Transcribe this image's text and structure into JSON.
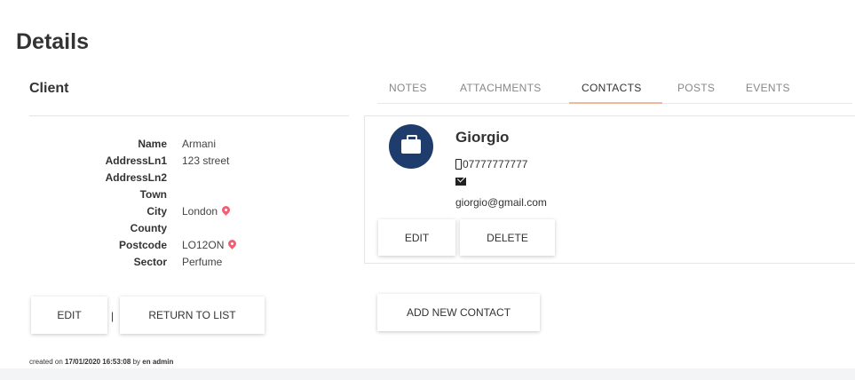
{
  "page": {
    "title": "Details"
  },
  "client": {
    "section_title": "Client",
    "fields": [
      {
        "label": "Name",
        "value": "Armani",
        "pin": false
      },
      {
        "label": "AddressLn1",
        "value": "123 street",
        "pin": false
      },
      {
        "label": "AddressLn2",
        "value": "",
        "pin": false
      },
      {
        "label": "Town",
        "value": "",
        "pin": false
      },
      {
        "label": "City",
        "value": "London",
        "pin": true
      },
      {
        "label": "County",
        "value": "",
        "pin": false
      },
      {
        "label": "Postcode",
        "value": "LO12ON",
        "pin": true
      },
      {
        "label": "Sector",
        "value": "Perfume",
        "pin": false
      }
    ],
    "edit_label": "EDIT",
    "separator": "|",
    "return_label": "RETURN TO LIST",
    "created_prefix": "created on",
    "created_date": "17/01/2020 16:53:08",
    "created_by": "by",
    "created_user": "en admin"
  },
  "tabs": [
    {
      "label": "NOTES",
      "active": false
    },
    {
      "label": "ATTACHMENTS",
      "active": false
    },
    {
      "label": "CONTACTS",
      "active": true
    },
    {
      "label": "POSTS",
      "active": false
    },
    {
      "label": "EVENTS",
      "active": false
    }
  ],
  "contact": {
    "name": "Giorgio",
    "phone": "07777777777",
    "email": "giorgio@gmail.com",
    "avatar_icon": "briefcase-icon",
    "edit_label": "EDIT",
    "delete_label": "DELETE"
  },
  "add_contact_label": "ADD NEW CONTACT",
  "colors": {
    "avatar": "#1f3d6c",
    "pin": "#f06074",
    "active_tab_underline": "#f0b89c"
  }
}
